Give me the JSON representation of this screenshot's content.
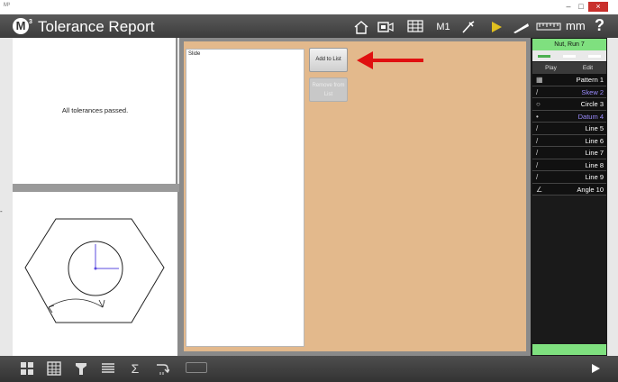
{
  "window": {
    "logo_text": "M³",
    "minimize_label": "–",
    "maximize_label": "□",
    "close_label": "×"
  },
  "header": {
    "title": "Tolerance Report",
    "m1_label": "M1",
    "unit_label": "mm",
    "help_label": "?"
  },
  "report": {
    "message": "All tolerances passed."
  },
  "slide_panel": {
    "label": "Slide",
    "add_button": "Add to List",
    "remove_button": "Remove from List"
  },
  "feature_panel": {
    "title": "Nut, Run 7",
    "tabs": [
      "Play",
      "Edit"
    ],
    "items": [
      {
        "name": "Pattern 1",
        "icon": "pattern-icon",
        "color": "#ffffff"
      },
      {
        "name": "Skew 2",
        "icon": "line-icon",
        "color": "#9b8cff"
      },
      {
        "name": "Circle 3",
        "icon": "circle-icon",
        "color": "#ffffff"
      },
      {
        "name": "Datum 4",
        "icon": "point-icon",
        "color": "#9b8cff"
      },
      {
        "name": "Line 5",
        "icon": "line-icon",
        "color": "#ffffff"
      },
      {
        "name": "Line 6",
        "icon": "line-icon",
        "color": "#ffffff"
      },
      {
        "name": "Line 7",
        "icon": "line-icon",
        "color": "#ffffff"
      },
      {
        "name": "Line 8",
        "icon": "line-icon",
        "color": "#ffffff"
      },
      {
        "name": "Line 9",
        "icon": "line-icon",
        "color": "#ffffff"
      },
      {
        "name": "Angle 10",
        "icon": "angle-icon",
        "color": "#ffffff"
      }
    ]
  },
  "colors": {
    "accent_green": "#7fe07f",
    "tan_background": "#e3b98c",
    "arrow_red": "#e01010",
    "datum_purple": "#9b8cff"
  },
  "bottom_toolbar": {
    "icons": [
      "grid-layout-icon",
      "table-icon",
      "probe-icon",
      "list-icon",
      "sigma-icon",
      "export-icon"
    ]
  }
}
